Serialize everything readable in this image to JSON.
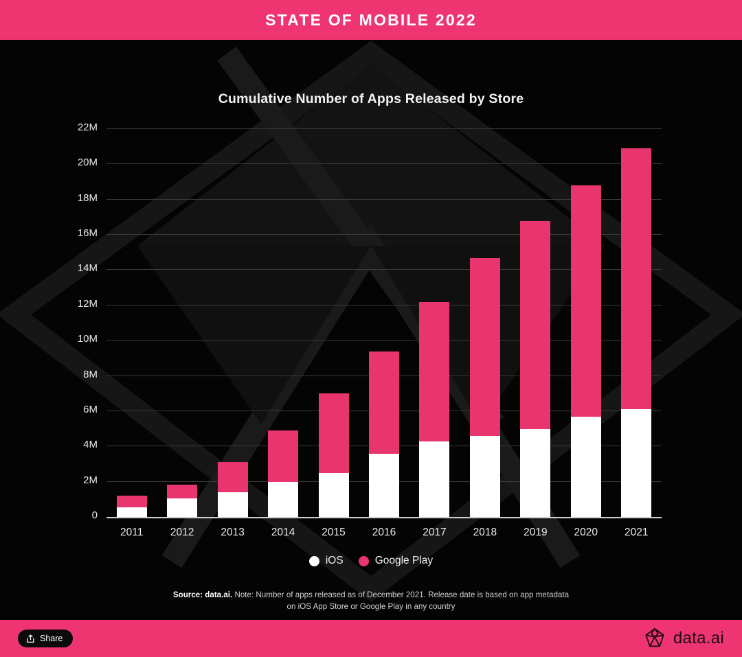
{
  "header": {
    "title": "STATE OF MOBILE 2022"
  },
  "footer": {
    "share_label": "Share",
    "share_icon": "share-export-icon",
    "brand_name": "data.ai",
    "brand_icon": "data-ai-diamond-logo"
  },
  "legend": {
    "items": [
      {
        "label": "iOS",
        "color": "#ffffff",
        "icon": "legend-dot-ios"
      },
      {
        "label": "Google Play",
        "color": "#e8356d",
        "icon": "legend-dot-google-play"
      }
    ]
  },
  "source": {
    "prefix": "Source: data.ai.",
    "note": " Note: Number of apps released as of December 2021. Release date is based on app metadata on iOS App Store or Google Play in any country"
  },
  "colors": {
    "accent_pink": "#ee3571",
    "bar_pink": "#e8356d",
    "bar_white": "#ffffff",
    "background": "#040404",
    "gridline": "#3a3a3a"
  },
  "chart_data": {
    "type": "bar",
    "title": "Cumulative Number of Apps Released by Store",
    "subtitle": "",
    "xlabel": "",
    "ylabel": "",
    "stacked": true,
    "grid": true,
    "legend_position": "bottom",
    "ylim": [
      0,
      22
    ],
    "y_unit": "millions of apps",
    "yticks": [
      0,
      2,
      4,
      6,
      8,
      10,
      12,
      14,
      16,
      18,
      20,
      22
    ],
    "ytick_labels": [
      "0",
      "2M",
      "4M",
      "6M",
      "8M",
      "10M",
      "12M",
      "14M",
      "16M",
      "18M",
      "20M",
      "22M"
    ],
    "categories": [
      "2011",
      "2012",
      "2013",
      "2014",
      "2015",
      "2016",
      "2017",
      "2018",
      "2019",
      "2020",
      "2021"
    ],
    "series": [
      {
        "name": "iOS",
        "color": "#ffffff",
        "values": [
          0.55,
          1.05,
          1.4,
          2.0,
          2.5,
          3.6,
          4.3,
          4.6,
          5.0,
          5.7,
          6.1
        ]
      },
      {
        "name": "Google Play",
        "color": "#e8356d",
        "values": [
          0.65,
          0.8,
          1.7,
          2.9,
          4.5,
          5.8,
          7.9,
          10.1,
          11.8,
          13.1,
          14.8
        ]
      }
    ],
    "totals": [
      1.2,
      1.85,
      3.1,
      4.9,
      7.0,
      9.4,
      12.2,
      14.7,
      16.8,
      18.8,
      20.9
    ]
  }
}
